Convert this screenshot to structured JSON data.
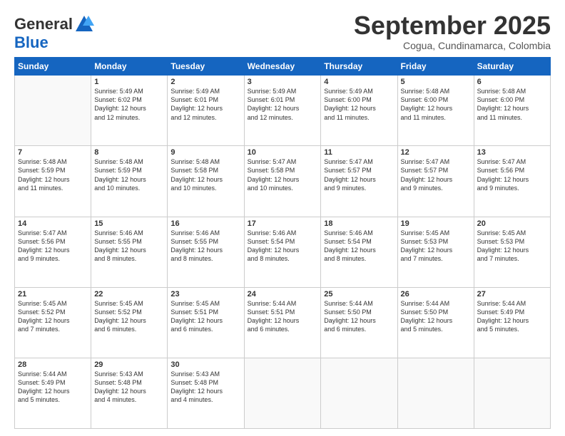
{
  "header": {
    "logo_general": "General",
    "logo_blue": "Blue",
    "month_title": "September 2025",
    "location": "Cogua, Cundinamarca, Colombia"
  },
  "weekdays": [
    "Sunday",
    "Monday",
    "Tuesday",
    "Wednesday",
    "Thursday",
    "Friday",
    "Saturday"
  ],
  "weeks": [
    [
      {
        "day": "",
        "info": ""
      },
      {
        "day": "1",
        "info": "Sunrise: 5:49 AM\nSunset: 6:02 PM\nDaylight: 12 hours\nand 12 minutes."
      },
      {
        "day": "2",
        "info": "Sunrise: 5:49 AM\nSunset: 6:01 PM\nDaylight: 12 hours\nand 12 minutes."
      },
      {
        "day": "3",
        "info": "Sunrise: 5:49 AM\nSunset: 6:01 PM\nDaylight: 12 hours\nand 12 minutes."
      },
      {
        "day": "4",
        "info": "Sunrise: 5:49 AM\nSunset: 6:00 PM\nDaylight: 12 hours\nand 11 minutes."
      },
      {
        "day": "5",
        "info": "Sunrise: 5:48 AM\nSunset: 6:00 PM\nDaylight: 12 hours\nand 11 minutes."
      },
      {
        "day": "6",
        "info": "Sunrise: 5:48 AM\nSunset: 6:00 PM\nDaylight: 12 hours\nand 11 minutes."
      }
    ],
    [
      {
        "day": "7",
        "info": "Sunrise: 5:48 AM\nSunset: 5:59 PM\nDaylight: 12 hours\nand 11 minutes."
      },
      {
        "day": "8",
        "info": "Sunrise: 5:48 AM\nSunset: 5:59 PM\nDaylight: 12 hours\nand 10 minutes."
      },
      {
        "day": "9",
        "info": "Sunrise: 5:48 AM\nSunset: 5:58 PM\nDaylight: 12 hours\nand 10 minutes."
      },
      {
        "day": "10",
        "info": "Sunrise: 5:47 AM\nSunset: 5:58 PM\nDaylight: 12 hours\nand 10 minutes."
      },
      {
        "day": "11",
        "info": "Sunrise: 5:47 AM\nSunset: 5:57 PM\nDaylight: 12 hours\nand 9 minutes."
      },
      {
        "day": "12",
        "info": "Sunrise: 5:47 AM\nSunset: 5:57 PM\nDaylight: 12 hours\nand 9 minutes."
      },
      {
        "day": "13",
        "info": "Sunrise: 5:47 AM\nSunset: 5:56 PM\nDaylight: 12 hours\nand 9 minutes."
      }
    ],
    [
      {
        "day": "14",
        "info": "Sunrise: 5:47 AM\nSunset: 5:56 PM\nDaylight: 12 hours\nand 9 minutes."
      },
      {
        "day": "15",
        "info": "Sunrise: 5:46 AM\nSunset: 5:55 PM\nDaylight: 12 hours\nand 8 minutes."
      },
      {
        "day": "16",
        "info": "Sunrise: 5:46 AM\nSunset: 5:55 PM\nDaylight: 12 hours\nand 8 minutes."
      },
      {
        "day": "17",
        "info": "Sunrise: 5:46 AM\nSunset: 5:54 PM\nDaylight: 12 hours\nand 8 minutes."
      },
      {
        "day": "18",
        "info": "Sunrise: 5:46 AM\nSunset: 5:54 PM\nDaylight: 12 hours\nand 8 minutes."
      },
      {
        "day": "19",
        "info": "Sunrise: 5:45 AM\nSunset: 5:53 PM\nDaylight: 12 hours\nand 7 minutes."
      },
      {
        "day": "20",
        "info": "Sunrise: 5:45 AM\nSunset: 5:53 PM\nDaylight: 12 hours\nand 7 minutes."
      }
    ],
    [
      {
        "day": "21",
        "info": "Sunrise: 5:45 AM\nSunset: 5:52 PM\nDaylight: 12 hours\nand 7 minutes."
      },
      {
        "day": "22",
        "info": "Sunrise: 5:45 AM\nSunset: 5:52 PM\nDaylight: 12 hours\nand 6 minutes."
      },
      {
        "day": "23",
        "info": "Sunrise: 5:45 AM\nSunset: 5:51 PM\nDaylight: 12 hours\nand 6 minutes."
      },
      {
        "day": "24",
        "info": "Sunrise: 5:44 AM\nSunset: 5:51 PM\nDaylight: 12 hours\nand 6 minutes."
      },
      {
        "day": "25",
        "info": "Sunrise: 5:44 AM\nSunset: 5:50 PM\nDaylight: 12 hours\nand 6 minutes."
      },
      {
        "day": "26",
        "info": "Sunrise: 5:44 AM\nSunset: 5:50 PM\nDaylight: 12 hours\nand 5 minutes."
      },
      {
        "day": "27",
        "info": "Sunrise: 5:44 AM\nSunset: 5:49 PM\nDaylight: 12 hours\nand 5 minutes."
      }
    ],
    [
      {
        "day": "28",
        "info": "Sunrise: 5:44 AM\nSunset: 5:49 PM\nDaylight: 12 hours\nand 5 minutes."
      },
      {
        "day": "29",
        "info": "Sunrise: 5:43 AM\nSunset: 5:48 PM\nDaylight: 12 hours\nand 4 minutes."
      },
      {
        "day": "30",
        "info": "Sunrise: 5:43 AM\nSunset: 5:48 PM\nDaylight: 12 hours\nand 4 minutes."
      },
      {
        "day": "",
        "info": ""
      },
      {
        "day": "",
        "info": ""
      },
      {
        "day": "",
        "info": ""
      },
      {
        "day": "",
        "info": ""
      }
    ]
  ]
}
